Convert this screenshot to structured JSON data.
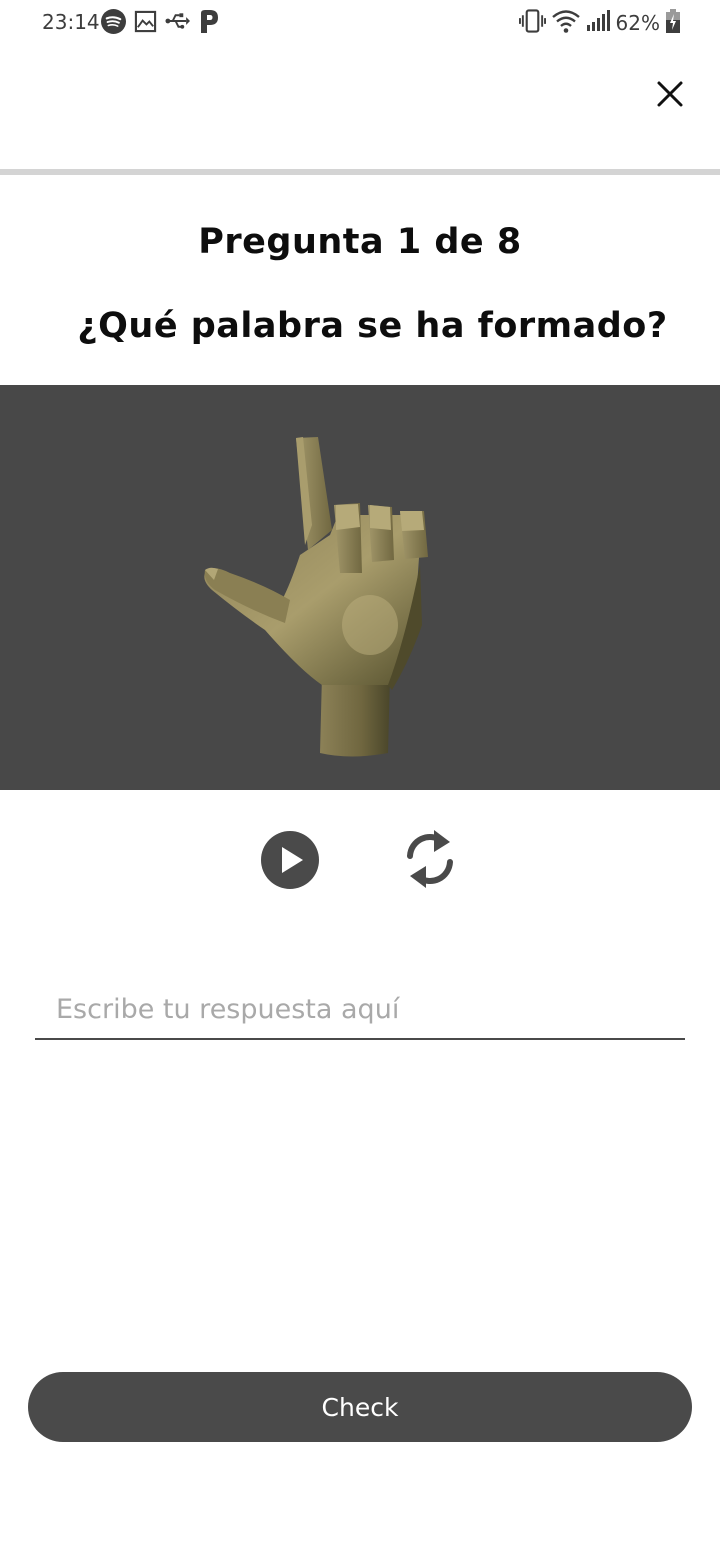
{
  "status_bar": {
    "time": "23:14",
    "battery": "62%",
    "left_icons": [
      "spotify-icon",
      "image-icon",
      "usb-icon",
      "parking-icon"
    ],
    "right_icons": [
      "vibrate-icon",
      "wifi-icon",
      "signal-icon",
      "battery-icon"
    ]
  },
  "header": {
    "close_icon": "close-icon"
  },
  "progress": {
    "fraction": 0
  },
  "quiz": {
    "counter": "Pregunta 1 de 8",
    "prompt": "¿Qué palabra se ha formado?"
  },
  "viewer": {
    "background": "#484848",
    "content": "hand-sign-model"
  },
  "controls": {
    "play_icon": "play-icon",
    "replay_icon": "refresh-icon"
  },
  "answer": {
    "placeholder": "Escribe tu respuesta aquí",
    "value": ""
  },
  "footer": {
    "check_label": "Check"
  },
  "colors": {
    "dark_button": "#4a4a4a",
    "progress_track": "#d4d4d4",
    "placeholder": "#a9a9a9"
  }
}
